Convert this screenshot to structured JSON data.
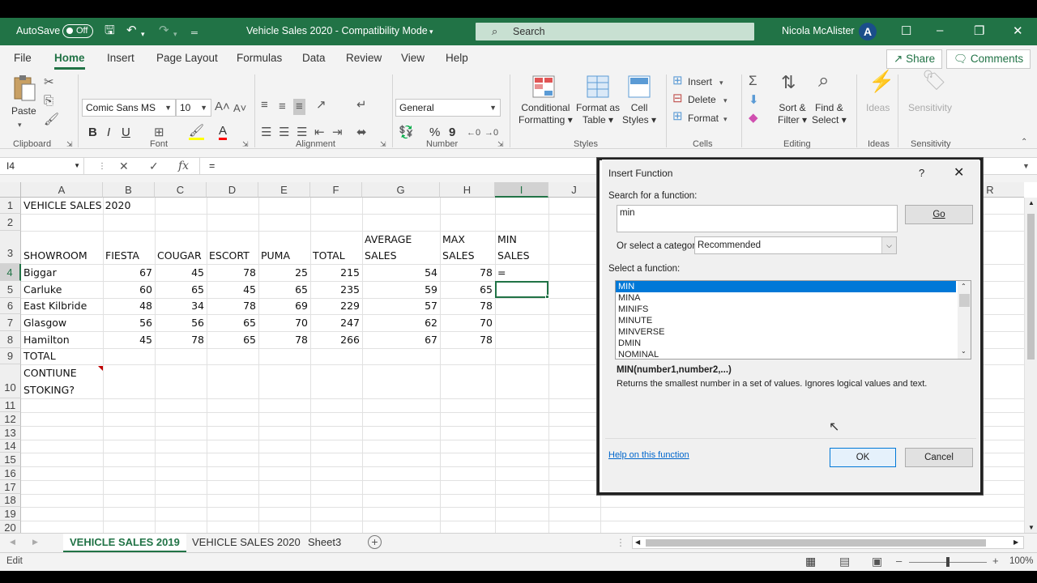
{
  "titlebar": {
    "autosave_label": "AutoSave",
    "autosave_state": "Off",
    "doc_title": "Vehicle Sales 2020  -  Compatibility Mode",
    "search_placeholder": "Search",
    "user_name": "Nicola McAlister",
    "avatar_letter": "A"
  },
  "tabs": [
    "File",
    "Home",
    "Insert",
    "Page Layout",
    "Formulas",
    "Data",
    "Review",
    "View",
    "Help"
  ],
  "share_label": "Share",
  "comments_label": "Comments",
  "ribbon": {
    "clipboard": {
      "paste": "Paste",
      "group": "Clipboard"
    },
    "font": {
      "name": "Comic Sans MS",
      "size": "10",
      "bold": "B",
      "italic": "I",
      "underline": "U",
      "group": "Font"
    },
    "alignment": {
      "group": "Alignment"
    },
    "number": {
      "format": "General",
      "percent": "%",
      "comma": "9",
      "group": "Number"
    },
    "styles": {
      "conditional": [
        "Conditional",
        "Formatting"
      ],
      "format_table": [
        "Format as",
        "Table"
      ],
      "cell_styles": [
        "Cell",
        "Styles"
      ],
      "group": "Styles"
    },
    "cells": {
      "insert": "Insert",
      "delete": "Delete",
      "format": "Format",
      "group": "Cells"
    },
    "editing": {
      "sort": [
        "Sort &",
        "Filter"
      ],
      "find": [
        "Find &",
        "Select"
      ],
      "group": "Editing"
    },
    "ideas": {
      "label": "Ideas",
      "group": "Ideas"
    },
    "sensitivity": {
      "label": "Sensitivity",
      "group": "Sensitivity"
    }
  },
  "formula_bar": {
    "name_box": "I4",
    "formula": "="
  },
  "columns": [
    "A",
    "B",
    "C",
    "D",
    "E",
    "F",
    "G",
    "H",
    "I",
    "J",
    "R"
  ],
  "rows": [
    "1",
    "2",
    "3",
    "4",
    "5",
    "6",
    "7",
    "8",
    "9",
    "10",
    "11",
    "12",
    "13",
    "14",
    "15",
    "16",
    "17",
    "18",
    "19",
    "20"
  ],
  "sheet": {
    "title": "VEHICLE SALES 2020",
    "headers": [
      "SHOWROOM",
      "FIESTA",
      "COUGAR",
      "ESCORT",
      "PUMA",
      "TOTAL"
    ],
    "avg_header": [
      "AVERAGE",
      "SALES"
    ],
    "max_header": [
      "MAX",
      "SALES"
    ],
    "min_header": [
      "MIN",
      "SALES"
    ],
    "data": [
      [
        "Biggar",
        "67",
        "45",
        "78",
        "25",
        "215",
        "54",
        "78",
        "="
      ],
      [
        "Carluke",
        "60",
        "65",
        "45",
        "65",
        "235",
        "59",
        "65",
        ""
      ],
      [
        "East Kilbride",
        "48",
        "34",
        "78",
        "69",
        "229",
        "57",
        "78",
        ""
      ],
      [
        "Glasgow",
        "56",
        "56",
        "65",
        "70",
        "247",
        "62",
        "70",
        ""
      ],
      [
        "Hamilton",
        "45",
        "78",
        "65",
        "78",
        "266",
        "67",
        "78",
        ""
      ]
    ],
    "total_label": "TOTAL",
    "continue_label": [
      "CONTIUNE",
      "STOKING?"
    ]
  },
  "sheet_tabs": [
    "VEHICLE SALES 2019",
    "VEHICLE SALES 2020",
    "Sheet3"
  ],
  "status": {
    "mode": "Edit",
    "zoom": "100%"
  },
  "dialog": {
    "title": "Insert Function",
    "help_q": "?",
    "search_label": "Search for a function:",
    "search_value": "min",
    "go": "Go",
    "category_label": "Or select a category:",
    "category_value": "Recommended",
    "select_label": "Select a function:",
    "functions": [
      "MIN",
      "MINA",
      "MINIFS",
      "MINUTE",
      "MINVERSE",
      "DMIN",
      "NOMINAL"
    ],
    "signature": "MIN(number1,number2,...)",
    "description": "Returns the smallest number in a set of values. Ignores logical values and text.",
    "help_link": "Help on this function",
    "ok": "OK",
    "cancel": "Cancel"
  }
}
